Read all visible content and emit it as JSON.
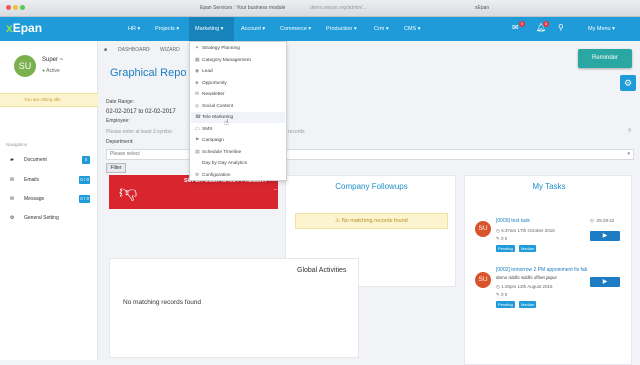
{
  "browser": {
    "tab_title": "Epan Services : Your business module",
    "url": "demo.xepan.org/admin/...",
    "right_title": "xEpan"
  },
  "topnav": {
    "logo_prefix": "x",
    "logo_main": "Epan",
    "items": [
      "HR ▾",
      "Projects ▾",
      "Marketing ▾",
      "Account ▾",
      "Commerce ▾",
      "Production ▾",
      "Crm ▾",
      "CMS ▾"
    ],
    "my_menu": "My Menu ▾",
    "mail_count": "0",
    "bell_count": "0"
  },
  "sidebar": {
    "avatar": "SU",
    "user_name": "Super ~",
    "status": "Active",
    "warning": "You are sitting idle",
    "nav_header": "Navigation",
    "items": [
      {
        "label": "Document",
        "badge": "0"
      },
      {
        "label": "Emails",
        "badge": "0 / 0"
      },
      {
        "label": "Message",
        "badge": "0 / 0"
      },
      {
        "label": "General Setting",
        "badge": ""
      }
    ]
  },
  "main": {
    "breadcrumb_dashboard": "DASHBOARD",
    "breadcrumb_wizard": "WIZARD",
    "page_title": "Graphical Repo",
    "reminder": "Reminder",
    "date_range_label": "Date Range:",
    "date_range_value": "02-02-2017 to 02-02-2017",
    "employee_label": "Employee:",
    "employee_placeholder": "Please enter at least 3 symbo",
    "employee_suffix": "records",
    "department_label": "Department:",
    "department_value": "Please select",
    "filter": "Filter",
    "super_user_msg": "SUPER USER IS NOT PRESENT",
    "company_followups": "Company Followups",
    "company_no_records": "No matching records found",
    "my_tasks": "My Tasks",
    "global_activities": "Global Activities",
    "global_no_records": "No matching records found"
  },
  "tasks": [
    {
      "avatar": "SU",
      "title": "[0009] test task",
      "date": "6:37am 17th October 2016",
      "time": "-25:29:42",
      "counts": "0  0",
      "tags": [
        "Pending",
        "Median"
      ]
    },
    {
      "avatar": "SU",
      "title": "[0002] tomorrow 2 PM appoinment fix fab",
      "line2": "demo riddhi siddhi offset jaipur",
      "date": "1:30pm 13th August 2016",
      "time": "",
      "counts": "0  0",
      "tags": [
        "Pending",
        "Median"
      ]
    }
  ],
  "marketing_menu": [
    "Strategy Planning",
    "Category Management",
    "Lead",
    "Opportunity",
    "Newsletter",
    "Social Content",
    "Tele Marketing",
    "SMS",
    "Campaign",
    "Schedule Timeline",
    "Day by Day Analytics",
    "Configuration"
  ],
  "colors": {
    "primary": "#1e9bd8",
    "active_nav": "#1683bb",
    "danger": "#d9262e",
    "teal": "#2ba7a3"
  }
}
